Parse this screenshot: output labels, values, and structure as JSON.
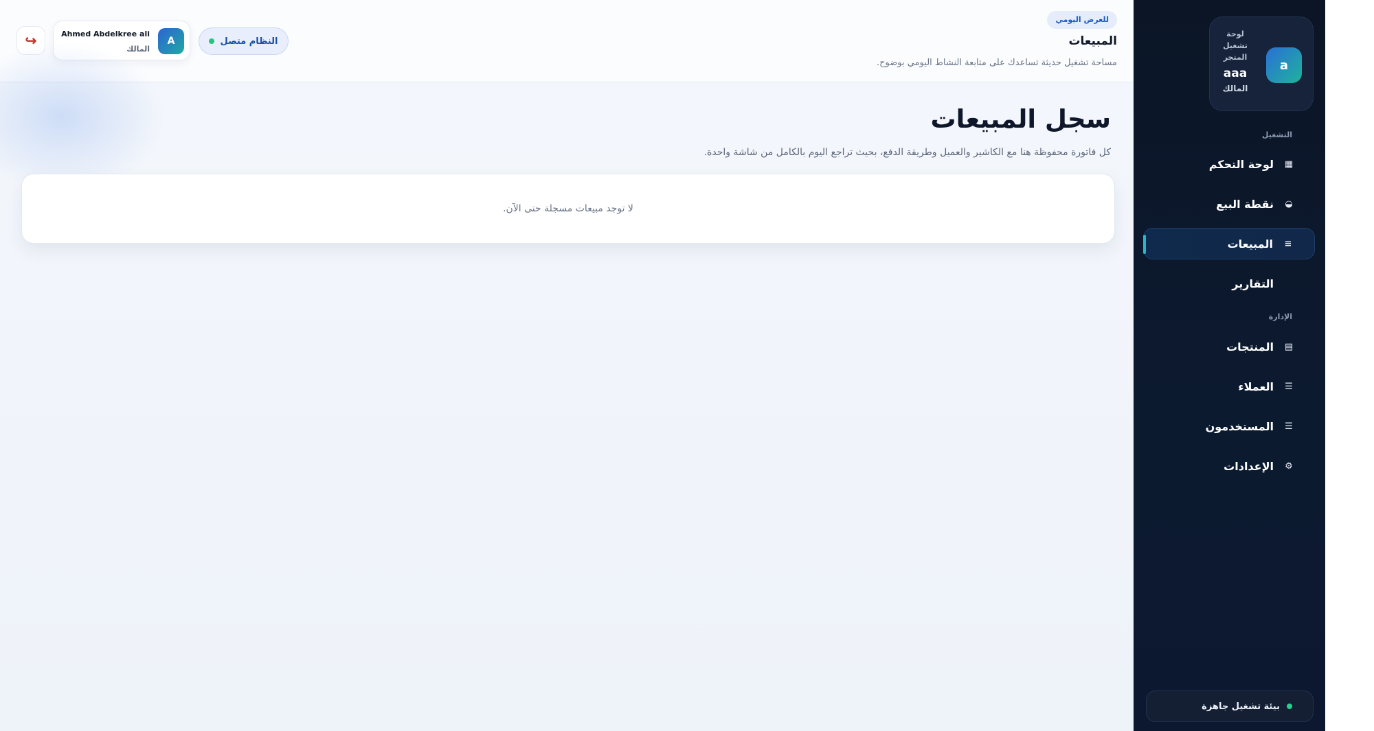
{
  "sidebar": {
    "store": {
      "avatar_letter": "a",
      "caption": "لوحة تشغيل المتجر",
      "name": "aaa",
      "role": "المالك"
    },
    "sections": {
      "operations": "التشغيل",
      "management": "الإدارة"
    },
    "items": [
      {
        "label": "لوحة التحكم",
        "icon": "grid-icon",
        "glyph": "▦",
        "active": false
      },
      {
        "label": "نقطة البيع",
        "icon": "pos-icon",
        "glyph": "◒",
        "active": false
      },
      {
        "label": "المبيعات",
        "icon": "list-icon",
        "glyph": "≡",
        "active": true
      },
      {
        "label": "التقارير",
        "icon": "",
        "glyph": "",
        "active": false
      },
      {
        "label": "المنتجات",
        "icon": "box-icon",
        "glyph": "▤",
        "active": false
      },
      {
        "label": "العملاء",
        "icon": "menu-icon",
        "glyph": "☰",
        "active": false
      },
      {
        "label": "المستخدمون",
        "icon": "menu-icon",
        "glyph": "☰",
        "active": false
      },
      {
        "label": "الإعدادات",
        "icon": "gear-icon",
        "glyph": "⚙",
        "active": false
      }
    ],
    "env_status": "بيئة تشغيل جاهزة"
  },
  "header": {
    "badge": "للعرض اليومي",
    "title": "المبيعات",
    "subtitle": "مساحة تشغيل حديثة تساعدك على متابعة النشاط اليومي بوضوح.",
    "system_status": "النظام متصل",
    "user": {
      "avatar_letter": "A",
      "name": "Ahmed Abdelkree ali",
      "role": "المالك"
    },
    "logout_glyph": "↪"
  },
  "main": {
    "title": "سجل المبيعات",
    "subtitle": "كل فاتورة محفوظة هنا مع الكاشير والعميل وطريقة الدفع، بحيث تراجع اليوم بالكامل من شاشة واحدة.",
    "empty_message": "لا توجد مبيعات مسجلة حتى الآن."
  },
  "colors": {
    "sidebar_bg": "#0b1526",
    "accent": "#28b6c8",
    "status_green": "#22c57c",
    "primary_blue": "#1c5bbf"
  }
}
